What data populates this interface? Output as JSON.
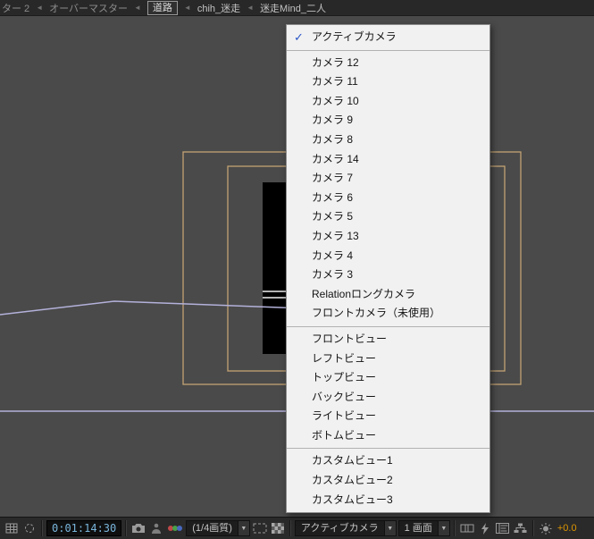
{
  "colors": {
    "viewport_bg": "#4a4a4a",
    "panel_bg": "#2a2a2a",
    "menu_bg": "#f1f1f1",
    "wireframe": "#c2a273",
    "path": "#b3b1da",
    "timecode_text": "#79b6dc",
    "exposure_text": "#dd9500",
    "checkmark": "#2a56c6"
  },
  "breadcrumb": {
    "separator": "◄",
    "items": [
      "ター 2",
      "オーバーマスター",
      "道路",
      "chih_迷走",
      "迷走Mind_二人"
    ],
    "current_index": 2
  },
  "camera_menu": {
    "checkmark": "✓",
    "groups": [
      [
        "アクティブカメラ"
      ],
      [
        "カメラ 12",
        "カメラ 11",
        "カメラ 10",
        "カメラ 9",
        "カメラ 8",
        "カメラ 14",
        "カメラ 7",
        "カメラ 6",
        "カメラ 5",
        "カメラ 13",
        "カメラ 4",
        "カメラ 3",
        "Relationロングカメラ",
        "フロントカメラ（未使用）"
      ],
      [
        "フロントビュー",
        "レフトビュー",
        "トップビュー",
        "バックビュー",
        "ライトビュー",
        "ボトムビュー"
      ],
      [
        "カスタムビュー1",
        "カスタムビュー2",
        "カスタムビュー3"
      ]
    ]
  },
  "toolbar": {
    "timecode": "0:01:14:30",
    "resolution_label": "(1/4画質)",
    "camera_label": "アクティブカメラ",
    "layout_label": "1 画面",
    "exposure": "+0.0",
    "dropdown_arrow": "▼"
  }
}
